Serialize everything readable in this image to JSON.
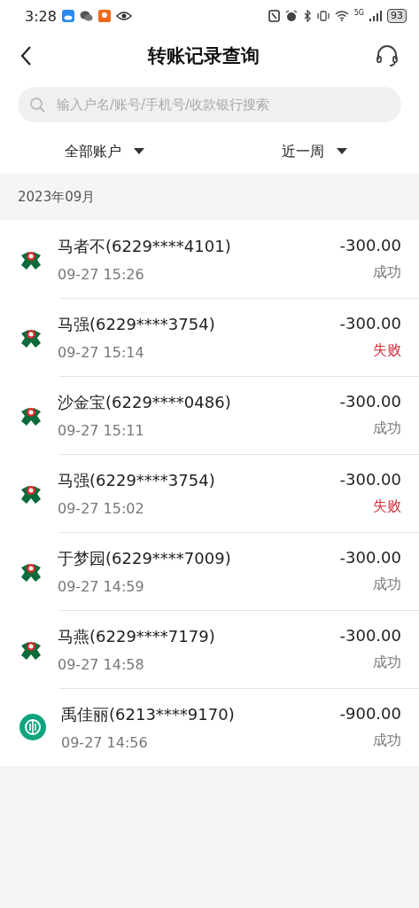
{
  "status_bar": {
    "time": "3:28",
    "network": "5G",
    "battery": "93"
  },
  "header": {
    "title": "转账记录查询"
  },
  "search": {
    "placeholder": "输入户名/账号/手机号/收款银行搜索"
  },
  "filters": [
    {
      "label": "全部账户"
    },
    {
      "label": "近一周"
    }
  ],
  "month": "2023年09月",
  "records": [
    {
      "kind": "abc",
      "name": "马者不(6229****4101)",
      "time": "09-27 15:26",
      "amount": "-300.00",
      "status": "成功",
      "failed": false
    },
    {
      "kind": "abc",
      "name": "马强(6229****3754)",
      "time": "09-27 15:14",
      "amount": "-300.00",
      "status": "失败",
      "failed": true
    },
    {
      "kind": "abc",
      "name": "沙金宝(6229****0486)",
      "time": "09-27 15:11",
      "amount": "-300.00",
      "status": "成功",
      "failed": false
    },
    {
      "kind": "abc",
      "name": "马强(6229****3754)",
      "time": "09-27 15:02",
      "amount": "-300.00",
      "status": "失败",
      "failed": true
    },
    {
      "kind": "abc",
      "name": "于梦园(6229****7009)",
      "time": "09-27 14:59",
      "amount": "-300.00",
      "status": "成功",
      "failed": false
    },
    {
      "kind": "abc",
      "name": "马燕(6229****7179)",
      "time": "09-27 14:58",
      "amount": "-300.00",
      "status": "成功",
      "failed": false
    },
    {
      "kind": "teal",
      "name": "禹佳丽(6213****9170)",
      "time": "09-27 14:56",
      "amount": "-900.00",
      "status": "成功",
      "failed": false
    }
  ]
}
